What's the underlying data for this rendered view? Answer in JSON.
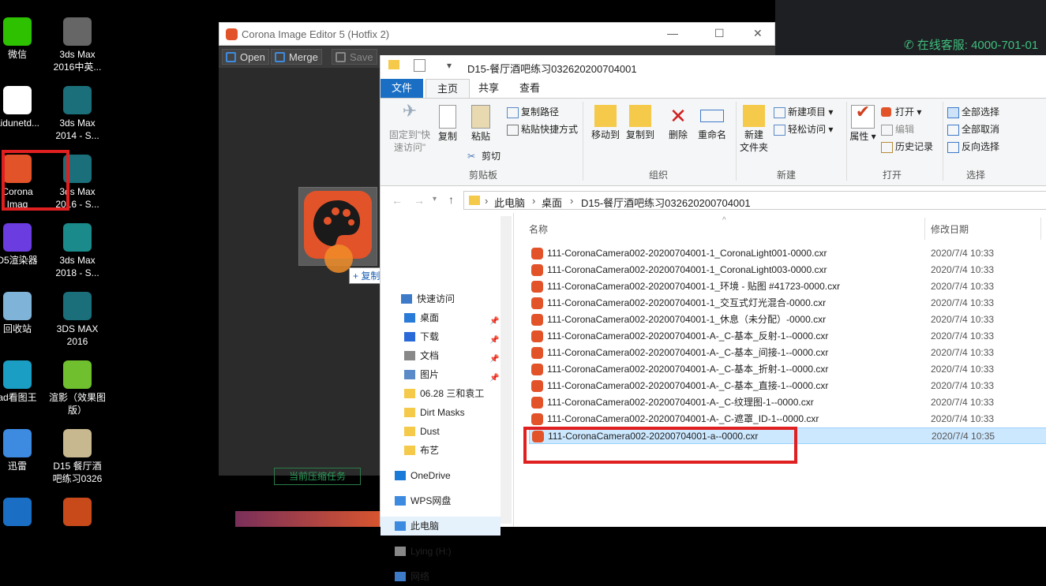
{
  "desktop": {
    "icons": [
      {
        "label": "微信",
        "color": "#2dc100"
      },
      {
        "label": "3ds Max\n2016中英...",
        "color": "#666"
      },
      {
        "label": "aidunetd...",
        "color": "#fff"
      },
      {
        "label": "3ds Max\n2014 - S...",
        "color": "#1a6f7a"
      },
      {
        "label": "Corona\nImag",
        "color": "#e3532a"
      },
      {
        "label": "3ds Max\n2016 - S...",
        "color": "#1a6f7a"
      },
      {
        "label": "D5渲染器",
        "color": "#6b3ce0"
      },
      {
        "label": "3ds Max\n2018 - S...",
        "color": "#1a8a8a"
      },
      {
        "label": "回收站",
        "color": "#7fb3d8"
      },
      {
        "label": "3DS MAX\n2016",
        "color": "#1a6f7a"
      },
      {
        "label": "ad看图王",
        "color": "#1a9ec4"
      },
      {
        "label": "渲影（效果图\n版）",
        "color": "#6fbf2f"
      },
      {
        "label": "迅雷",
        "color": "#3d8be0"
      },
      {
        "label": "D15 餐厅酒\n吧练习0326",
        "color": "#c8b890"
      },
      {
        "label": "",
        "color": "#1a6fc4"
      },
      {
        "label": "",
        "color": "#c84a1a"
      }
    ]
  },
  "hotline": "在线客服: 4000-701-01",
  "corona": {
    "title": "Corona Image Editor 5 (Hotfix 2)",
    "toolbar": {
      "open": "Open",
      "merge": "Merge",
      "save": "Save"
    },
    "compress_button": "当前压缩任务",
    "copy_tip": "+ 复制"
  },
  "explorer": {
    "title": "D15-餐厅酒吧练习032620200704001",
    "tabs": [
      "文件",
      "主页",
      "共享",
      "查看"
    ],
    "ribbon": {
      "pin": "固定到\"快\n速访问\"",
      "copy": "复制",
      "paste": "粘贴",
      "copy_path": "复制路径",
      "paste_shortcut": "粘贴快捷方式",
      "cut": "剪切",
      "clipboard": "剪贴板",
      "move_to": "移动到",
      "copy_to": "复制到",
      "delete": "删除",
      "rename": "重命名",
      "organize": "组织",
      "new_folder": "新建\n文件夹",
      "new_item": "新建项目",
      "easy_access": "轻松访问",
      "new": "新建",
      "properties": "属性",
      "open": "打开",
      "edit": "编辑",
      "history": "历史记录",
      "open_group": "打开",
      "select_all": "全部选择",
      "select_none": "全部取消",
      "invert": "反向选择",
      "select": "选择"
    },
    "breadcrumb": [
      "此电脑",
      "桌面",
      "D15-餐厅酒吧练习032620200704001"
    ],
    "nav": [
      {
        "label": "快速访问",
        "pinned": false
      },
      {
        "label": "桌面",
        "pinned": true
      },
      {
        "label": "下载",
        "pinned": true
      },
      {
        "label": "文档",
        "pinned": true
      },
      {
        "label": "图片",
        "pinned": true
      },
      {
        "label": "06.28 三和袁工",
        "pinned": false
      },
      {
        "label": "Dirt Masks",
        "pinned": false
      },
      {
        "label": "Dust",
        "pinned": false
      },
      {
        "label": "布艺",
        "pinned": false
      },
      {
        "label": "OneDrive",
        "pinned": false
      },
      {
        "label": "WPS网盘",
        "pinned": false
      },
      {
        "label": "此电脑",
        "pinned": false
      },
      {
        "label": "Lying (H:)",
        "pinned": false
      },
      {
        "label": "网络",
        "pinned": false
      }
    ],
    "columns": {
      "name": "名称",
      "date": "修改日期"
    },
    "files": [
      {
        "name": "111-CoronaCamera002-20200704001-1_CoronaLight001-0000.cxr",
        "date": "2020/7/4 10:33"
      },
      {
        "name": "111-CoronaCamera002-20200704001-1_CoronaLight003-0000.cxr",
        "date": "2020/7/4 10:33"
      },
      {
        "name": "111-CoronaCamera002-20200704001-1_环境 - 贴图 #41723-0000.cxr",
        "date": "2020/7/4 10:33"
      },
      {
        "name": "111-CoronaCamera002-20200704001-1_交互式灯光混合-0000.cxr",
        "date": "2020/7/4 10:33"
      },
      {
        "name": "111-CoronaCamera002-20200704001-1_休息（未分配）-0000.cxr",
        "date": "2020/7/4 10:33"
      },
      {
        "name": "111-CoronaCamera002-20200704001-A-_C-基本_反射-1--0000.cxr",
        "date": "2020/7/4 10:33"
      },
      {
        "name": "111-CoronaCamera002-20200704001-A-_C-基本_间接-1--0000.cxr",
        "date": "2020/7/4 10:33"
      },
      {
        "name": "111-CoronaCamera002-20200704001-A-_C-基本_折射-1--0000.cxr",
        "date": "2020/7/4 10:33"
      },
      {
        "name": "111-CoronaCamera002-20200704001-A-_C-基本_直接-1--0000.cxr",
        "date": "2020/7/4 10:33"
      },
      {
        "name": "111-CoronaCamera002-20200704001-A-_C-纹理图-1--0000.cxr",
        "date": "2020/7/4 10:33"
      },
      {
        "name": "111-CoronaCamera002-20200704001-A-_C-遮罩_ID-1--0000.cxr",
        "date": "2020/7/4 10:33"
      },
      {
        "name": "111-CoronaCamera002-20200704001-a--0000.cxr",
        "date": "2020/7/4 10:35"
      }
    ]
  }
}
